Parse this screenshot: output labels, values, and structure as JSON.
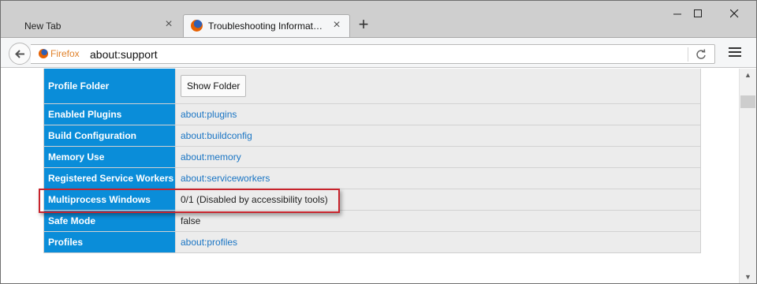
{
  "tabs": [
    {
      "title": "New Tab",
      "active": false
    },
    {
      "title": "Troubleshooting Informat…",
      "active": true
    }
  ],
  "navbar": {
    "identity_label": "Firefox",
    "url": "about:support"
  },
  "table": {
    "rows": [
      {
        "key": "Profile Folder",
        "value": "Show Folder",
        "type": "button"
      },
      {
        "key": "Enabled Plugins",
        "value": "about:plugins",
        "type": "link"
      },
      {
        "key": "Build Configuration",
        "value": "about:buildconfig",
        "type": "link"
      },
      {
        "key": "Memory Use",
        "value": "about:memory",
        "type": "link"
      },
      {
        "key": "Registered Service Workers",
        "value": "about:serviceworkers",
        "type": "link"
      },
      {
        "key": "Multiprocess Windows",
        "value": "0/1 (Disabled by accessibility tools)",
        "type": "text"
      },
      {
        "key": "Safe Mode",
        "value": "false",
        "type": "text"
      },
      {
        "key": "Profiles",
        "value": "about:profiles",
        "type": "link"
      }
    ]
  },
  "colors": {
    "key_cell": "#0a8dd9",
    "link": "#1a75c4",
    "highlight_box": "#c8232c",
    "identity": "#e0822b"
  },
  "icons": [
    "firefox-icon",
    "close-icon",
    "plus-icon",
    "minimize-icon",
    "maximize-icon",
    "back-arrow-icon",
    "reload-icon",
    "hamburger-menu-icon",
    "scroll-up-arrow-icon",
    "scroll-down-arrow-icon"
  ]
}
